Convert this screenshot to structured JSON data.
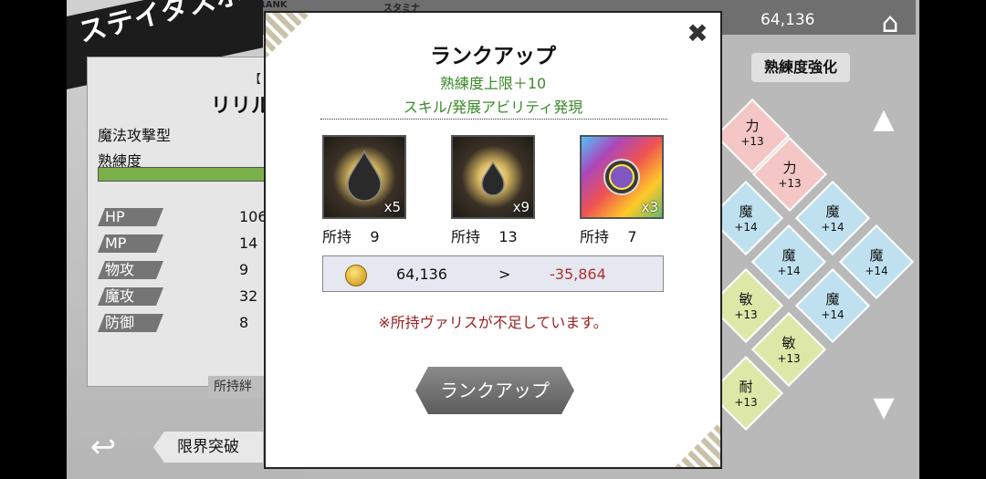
{
  "screen": {
    "title": "ステイタスボード",
    "rank_label": "RANK",
    "stamina_label": "スタミナ",
    "gold": "64,136",
    "home_icon": "home-icon"
  },
  "character": {
    "bracket": "【",
    "name": "リリル",
    "type": "魔法攻撃型",
    "proficiency_label": "熟練度",
    "stats": [
      {
        "label": "HP",
        "value": "106"
      },
      {
        "label": "MP",
        "value": "14"
      },
      {
        "label": "物攻",
        "value": "9"
      },
      {
        "label": "魔攻",
        "value": "32"
      },
      {
        "label": "防御",
        "value": "8"
      }
    ],
    "own_bond_label": "所持絆",
    "limit_break_label": "限界突破"
  },
  "board": {
    "proficiency_boost_label": "熟練度強化",
    "tiles": [
      {
        "label": "力",
        "bonus": "+13",
        "color": "red"
      },
      {
        "label": "力",
        "bonus": "+13",
        "color": "red"
      },
      {
        "label": "魔",
        "bonus": "+14",
        "color": "blue"
      },
      {
        "label": "魔",
        "bonus": "+14",
        "color": "blue"
      },
      {
        "label": "魔",
        "bonus": "+14",
        "color": "blue"
      },
      {
        "label": "魔",
        "bonus": "+14",
        "color": "blue"
      },
      {
        "label": "敏",
        "bonus": "+13",
        "color": "green"
      },
      {
        "label": "魔",
        "bonus": "+14",
        "color": "blue"
      },
      {
        "label": "敏",
        "bonus": "+13",
        "color": "green"
      },
      {
        "label": "耐",
        "bonus": "+13",
        "color": "green"
      }
    ]
  },
  "modal": {
    "title": "ランクアップ",
    "subtitle1": "熟練度上限＋10",
    "subtitle2": "スキル/発展アビリティ発現",
    "items": [
      {
        "qty": "x5",
        "owned_label": "所持",
        "owned": "9"
      },
      {
        "qty": "x9",
        "owned_label": "所持",
        "owned": "13"
      },
      {
        "qty": "x3",
        "owned_label": "所持",
        "owned": "7"
      }
    ],
    "gold_current": "64,136",
    "gold_arrow": ">",
    "gold_cost": "-35,864",
    "warning": "※所持ヴァリスが不足しています。",
    "button": "ランクアップ",
    "close_icon": "close-icon"
  },
  "colors": {
    "accent_green": "#3a8a2a",
    "warning_red": "#9a2020",
    "cost_red": "#b03030"
  }
}
